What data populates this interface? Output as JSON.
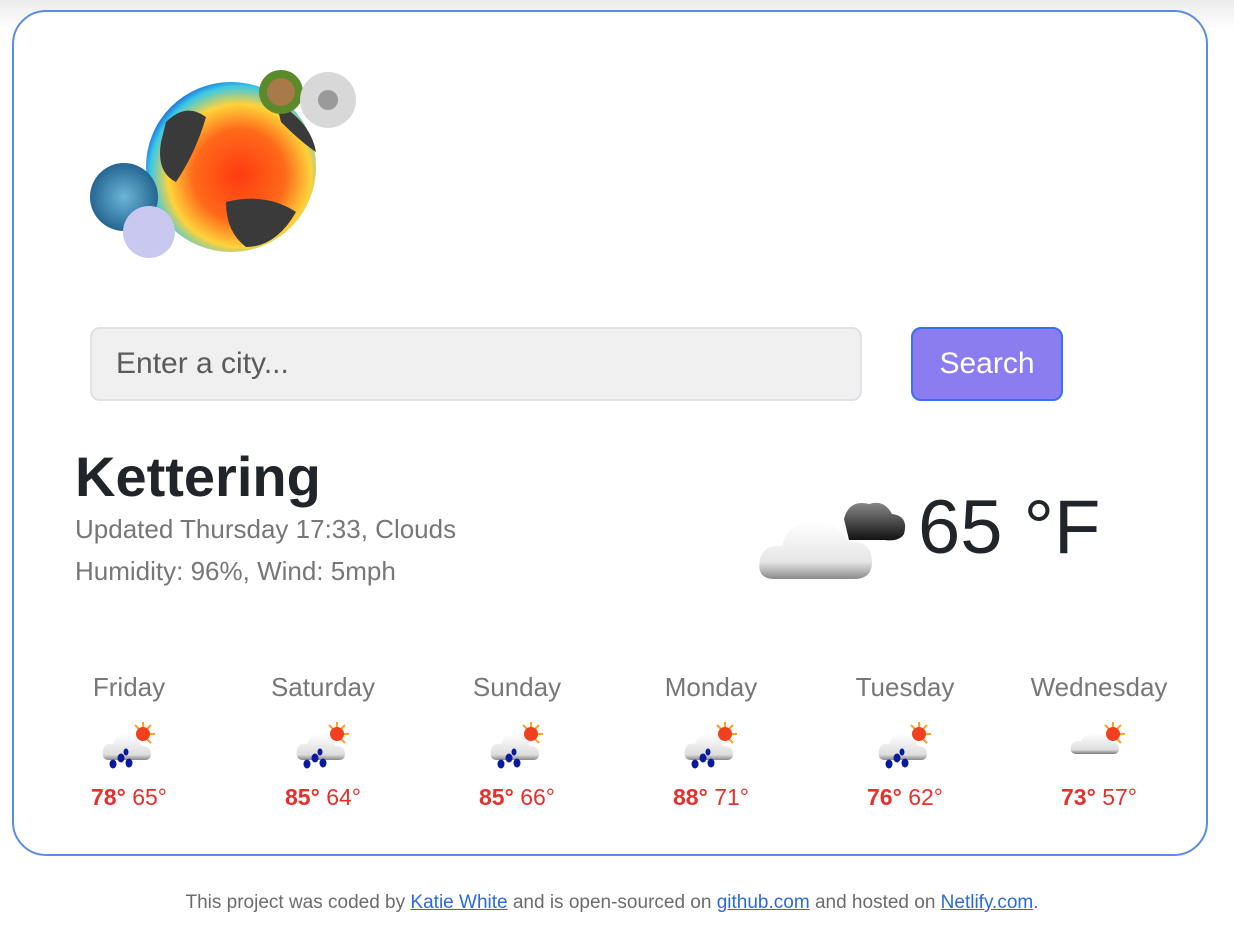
{
  "search": {
    "placeholder": "Enter a city...",
    "button_label": "Search"
  },
  "current": {
    "city": "Kettering",
    "updated": "Updated Thursday 17:33, Clouds",
    "details": "Humidity: 96%, Wind: 5mph",
    "temperature": "65 °F",
    "icon": "cloudy-icon"
  },
  "forecast": [
    {
      "day": "Friday",
      "max": "78°",
      "min": "65°",
      "icon": "rain-sun-icon"
    },
    {
      "day": "Saturday",
      "max": "85°",
      "min": "64°",
      "icon": "rain-sun-icon"
    },
    {
      "day": "Sunday",
      "max": "85°",
      "min": "66°",
      "icon": "rain-sun-icon"
    },
    {
      "day": "Monday",
      "max": "88°",
      "min": "71°",
      "icon": "rain-sun-icon"
    },
    {
      "day": "Tuesday",
      "max": "76°",
      "min": "62°",
      "icon": "rain-sun-icon"
    },
    {
      "day": "Wednesday",
      "max": "73°",
      "min": "57°",
      "icon": "partly-cloudy-icon"
    }
  ],
  "footer": {
    "text1": "This project was coded by ",
    "author": "Katie White",
    "text2": " and is open-sourced on ",
    "repo": "github.com",
    "text3": " and hosted on ",
    "host": "Netlify.com",
    "text4": "."
  },
  "colors": {
    "accent": "#8b7cf0",
    "border": "#5b8de3",
    "temp_red": "#e8302a"
  }
}
